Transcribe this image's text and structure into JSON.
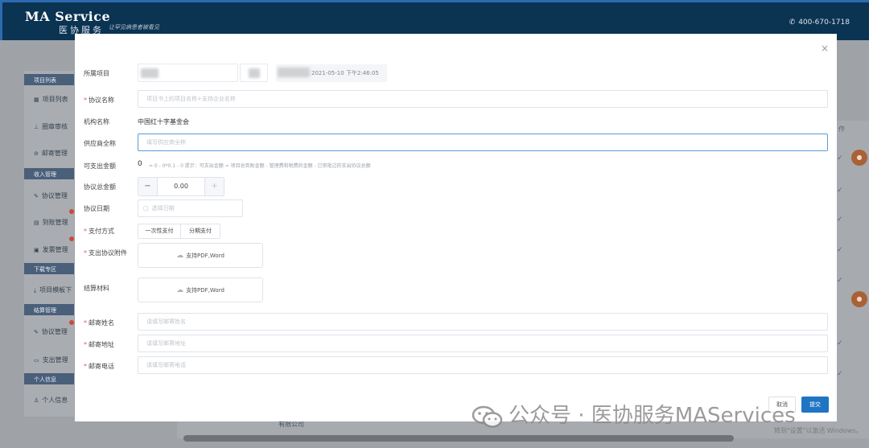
{
  "app": {
    "logo_en": "MA Service",
    "logo_cn": "医协服务",
    "logo_sub": "让罕见病患者被看见",
    "phone": "400-670-1718"
  },
  "background": {
    "sidebar": {
      "groups": [
        {
          "head": "项目列表",
          "items": [
            "项目列表",
            "圈章审核",
            "邮寄管理"
          ]
        },
        {
          "head": "收入管理",
          "items": [
            "协议管理",
            "到账管理",
            "发票管理"
          ]
        },
        {
          "head": "下载专区",
          "items": [
            "项目模板下"
          ]
        },
        {
          "head": "结算管理",
          "items": [
            "协议管理",
            "支出管理"
          ]
        },
        {
          "head": "个人信息",
          "items": [
            "个人信息"
          ]
        }
      ]
    },
    "table_col_label": "作",
    "bottom_text": "有限公司"
  },
  "modal": {
    "close_icon": "close-icon",
    "fields": {
      "project_label": "所属项目",
      "project_date": "2021-05-10 下午2:46:05",
      "agreement_name_label": "协议名称",
      "agreement_name_placeholder": "项目书上的项目名称+支持企业名称",
      "org_label": "机构名称",
      "org_value": "中国红十字基金会",
      "supplier_label": "供应商全称",
      "supplier_placeholder": "填写供应商全称",
      "available_label": "可支出金额",
      "available_value": "0",
      "available_hint": "= 0 - 0*0.1 - 0    提示：可支出金额 = 项目总到账金额 - 管理费和税费的金额 - 已审批过的支出协议总额",
      "total_label": "协议总金额",
      "total_value": "0.00",
      "minus": "−",
      "plus": "+",
      "date_label": "协议日期",
      "date_placeholder": "选择日期",
      "pay_label": "支付方式",
      "pay_options": [
        "一次性支付",
        "分期支付"
      ],
      "attach_label": "支出协议附件",
      "attach_text": "支持PDF,Word",
      "settle_label": "结算材料",
      "settle_text": "支持PDF,Word",
      "mail_name_label": "邮寄姓名",
      "mail_name_placeholder": "请填写邮寄姓名",
      "mail_addr_label": "邮寄地址",
      "mail_addr_placeholder": "请填写邮寄地址",
      "mail_phone_label": "邮寄电话",
      "mail_phone_placeholder": "请填写邮寄电话"
    },
    "buttons": {
      "cancel": "取消",
      "submit": "提交"
    }
  },
  "overlay": {
    "watermark": "公众号 · 医协服务MAServices",
    "windows_activation": "转到\"设置\"以激活 Windows。"
  },
  "colors": {
    "topbar": "#0b3352",
    "primary": "#1f74c3",
    "required": "#e5584f"
  }
}
